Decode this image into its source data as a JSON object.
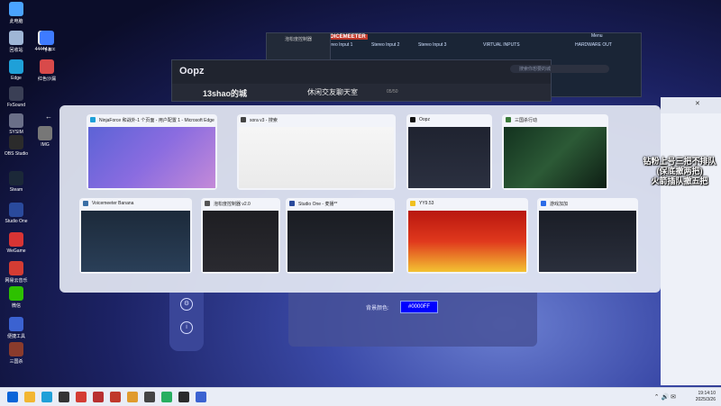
{
  "desktop": {
    "icons": [
      {
        "label": "此电脑",
        "color": "#4aa3ff"
      },
      {
        "label": "回收站",
        "color": "#9fb6d6"
      },
      {
        "label": "44444.scc",
        "color": "#e8e8e8"
      },
      {
        "label": "飞书",
        "color": "#3e7bff"
      },
      {
        "label": "Edge",
        "color": "#1fa0d8"
      },
      {
        "label": "红色沙漏",
        "color": "#d84a4a"
      },
      {
        "label": "FxSound",
        "color": "#3a3f55"
      },
      {
        "label": "SYSIM",
        "color": "#6a6f88"
      },
      {
        "label": "OBS Studio",
        "color": "#2b2b2b"
      },
      {
        "label": "IMG",
        "color": "#777"
      },
      {
        "label": "Steam",
        "color": "#1b2838"
      },
      {
        "label": "Studio One",
        "color": "#2a4a9c"
      },
      {
        "label": "WeGame",
        "color": "#d83434"
      },
      {
        "label": "网易云音乐",
        "color": "#d43c33"
      },
      {
        "label": "微信",
        "color": "#2dc100"
      },
      {
        "label": "便捷工具",
        "color": "#3b62d1"
      },
      {
        "label": "三国杀",
        "color": "#8a3b2c"
      }
    ]
  },
  "background_apps": {
    "voicemeeter": {
      "brand": "VOICEMEETER",
      "inputs": [
        "Stereo Input 1",
        "Stereo Input 2",
        "Stereo Input 3"
      ],
      "virtual": "VIRTUAL INPUTS",
      "hw_out": "HARDWARE OUT",
      "menu": "Menu"
    },
    "oopz": {
      "logo": "Oopz",
      "channel": "13shao的城",
      "room": "休闲交友聊天室",
      "count": "05/50",
      "search_placeholder": "搜索你想要的城"
    },
    "small_window_title": "泡松度控制器"
  },
  "task_view": {
    "windows": [
      {
        "title": "NinjaForce 和战外·1 个页面 - 用户配置 1 - Microsoft Edge",
        "icon": "edge-icon",
        "icon_color": "#1fa0d8",
        "preview": "linear-gradient(135deg,#5c63d6,#8a6ce0 50%,#c48ad8)"
      },
      {
        "title": "sora v3 - 搜索",
        "icon": "search-icon",
        "icon_color": "#444",
        "preview": "linear-gradient(#f6f6f6,#eaeaea)"
      },
      {
        "title": "Oopz",
        "icon": "oopz-icon",
        "icon_color": "#111",
        "preview": "linear-gradient(#1f2330,#2b3040)"
      },
      {
        "title": "三国杀行动",
        "icon": "game-icon",
        "icon_color": "#3a7a3a",
        "preview": "linear-gradient(135deg,#13321f,#2c5a36 50%,#0e1e14)"
      },
      {
        "title": "Voicemeeter Banana",
        "icon": "voicemeeter-icon",
        "icon_color": "#3a6ea5",
        "preview": "linear-gradient(#1c2a3a,#2a3f58)"
      },
      {
        "title": "泡松度控制器 v2.0",
        "icon": "tool-icon",
        "icon_color": "#555",
        "preview": "linear-gradient(#1e1e22,#2a2a30)"
      },
      {
        "title": "Studio One - 麦播**",
        "icon": "studio-one-icon",
        "icon_color": "#2a4a9c",
        "preview": "linear-gradient(#1a1c22,#262a33)"
      },
      {
        "title": "YY9.53",
        "icon": "yy-icon",
        "icon_color": "#f0c020",
        "preview": "linear-gradient(#b8170f,#e0381d 50%,#f3c232)"
      },
      {
        "title": "游戏加加",
        "icon": "gameplus-icon",
        "icon_color": "#2b6be8",
        "preview": "linear-gradient(#1a1d26,#2a2f3c)"
      }
    ]
  },
  "overlay": {
    "lines": [
      "钻粉上号三把不排队",
      "(保底撤两把)",
      "火箭插队撤五把"
    ]
  },
  "settings_app": {
    "color_label": "背景颜色:",
    "color_value": "#0000FF"
  },
  "taskbar": {
    "apps": [
      {
        "name": "windows-start",
        "color": "#0a64d8"
      },
      {
        "name": "file-explorer",
        "color": "#f2b632"
      },
      {
        "name": "edge",
        "color": "#1fa0d8"
      },
      {
        "name": "media",
        "color": "#333"
      },
      {
        "name": "netease",
        "color": "#d43c33"
      },
      {
        "name": "app-red",
        "color": "#b83030"
      },
      {
        "name": "app-game",
        "color": "#c0392b"
      },
      {
        "name": "app-multi",
        "color": "#e09b2d"
      },
      {
        "name": "app-z",
        "color": "#444"
      },
      {
        "name": "app-green",
        "color": "#27ae60"
      },
      {
        "name": "app-dark",
        "color": "#2b2b2b"
      },
      {
        "name": "app-active",
        "color": "#3b62d1"
      }
    ],
    "time": "19:14:10",
    "date": "2025/3/26"
  }
}
